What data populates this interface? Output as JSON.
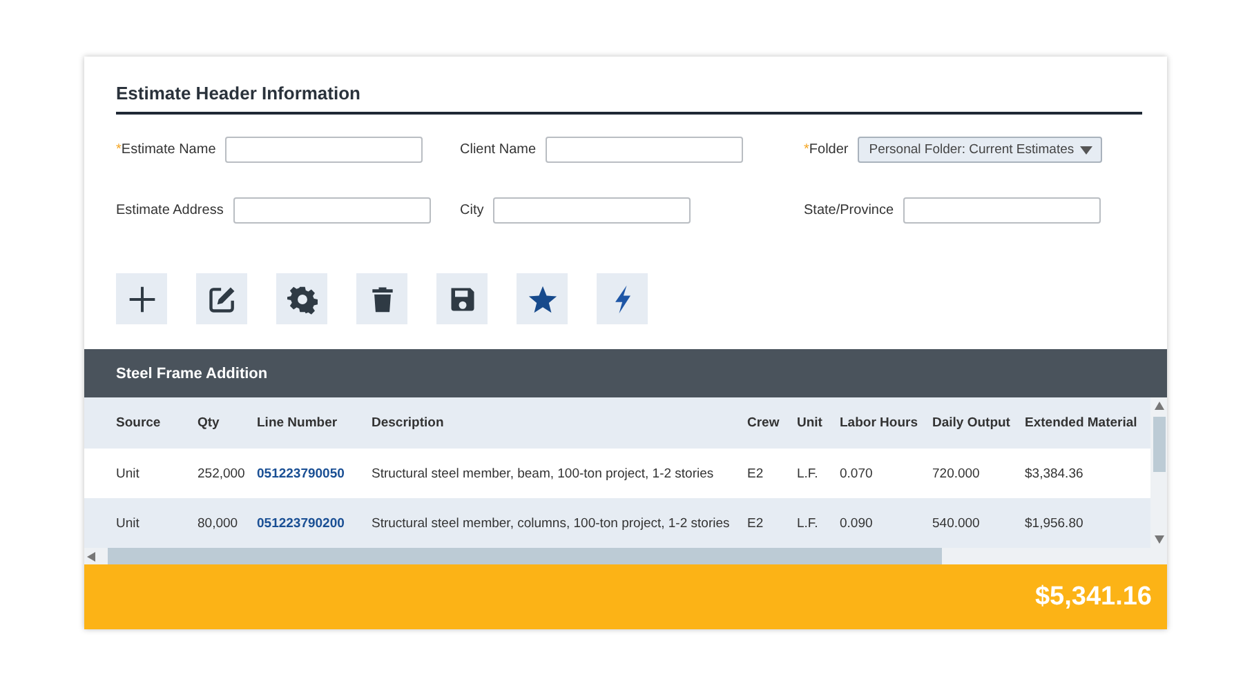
{
  "header": {
    "title": "Estimate Header Information"
  },
  "fields": [
    {
      "label": "Estimate Name",
      "required_mark": "*",
      "kind": "text"
    },
    {
      "label": "Client Name",
      "kind": "text"
    },
    {
      "label": "Folder",
      "required_mark": "*",
      "kind": "dropdown",
      "value": "Personal Folder: Current Estimates"
    },
    {
      "label": "Estimate Address",
      "kind": "text"
    },
    {
      "label": "City",
      "kind": "text"
    },
    {
      "label": "State/Province",
      "kind": "text"
    }
  ],
  "section": {
    "title": "Steel Frame Addition"
  },
  "table": {
    "columns": [
      {
        "label": "Source",
        "kind": "text"
      },
      {
        "label": "Qty",
        "kind": "text"
      },
      {
        "label": "Line Number",
        "kind": "link"
      },
      {
        "label": "Description",
        "kind": "text"
      },
      {
        "label": "Crew",
        "kind": "text"
      },
      {
        "label": "Unit",
        "kind": "text"
      },
      {
        "label": "Labor Hours",
        "kind": "text"
      },
      {
        "label": "Daily Output",
        "kind": "text"
      },
      {
        "label": "Extended Material",
        "kind": "text"
      }
    ],
    "rows": [
      [
        "Unit",
        "252,000",
        "051223790050",
        "Structural steel member, beam, 100-ton project, 1-2 stories",
        "E2",
        "L.F.",
        "0.070",
        "720.000",
        "$3,384.36"
      ],
      [
        "Unit",
        "80,000",
        "051223790200",
        "Structural steel member, columns, 100-ton project, 1-2 stories",
        "E2",
        "L.F.",
        "0.090",
        "540.000",
        "$1,956.80"
      ]
    ]
  },
  "total": "$5,341.16"
}
